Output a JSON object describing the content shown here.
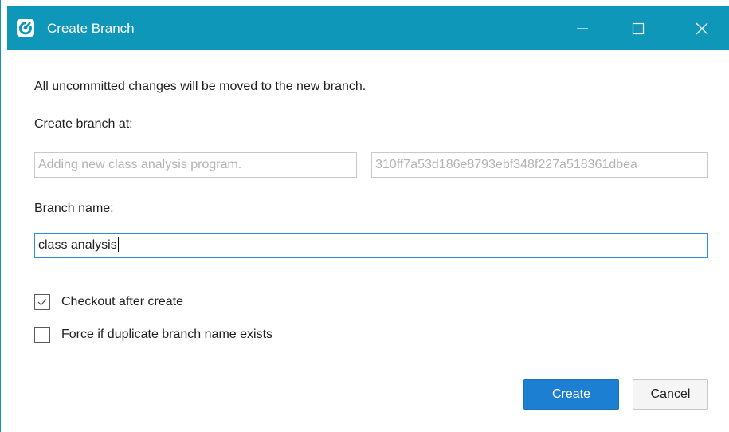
{
  "window": {
    "title": "Create Branch",
    "app_icon": "git-app-icon",
    "controls": {
      "minimize": "minimize-icon",
      "maximize": "maximize-icon",
      "close": "close-icon"
    },
    "accent": "#0e97b8"
  },
  "dialog": {
    "info_text": "All uncommitted changes will be moved to the new branch.",
    "branch_at_label": "Create branch at:",
    "commit_message": "Adding new class analysis program.",
    "commit_hash": "310ff7a53d186e8793ebf348f227a518361dbea",
    "branch_name_label": "Branch name:",
    "branch_name_value": "class analysis",
    "checkboxes": [
      {
        "label": "Checkout after create",
        "checked": true
      },
      {
        "label": "Force if duplicate branch name exists",
        "checked": false
      }
    ],
    "buttons": {
      "create": "Create",
      "cancel": "Cancel"
    },
    "primary_color": "#1d7fd1"
  }
}
